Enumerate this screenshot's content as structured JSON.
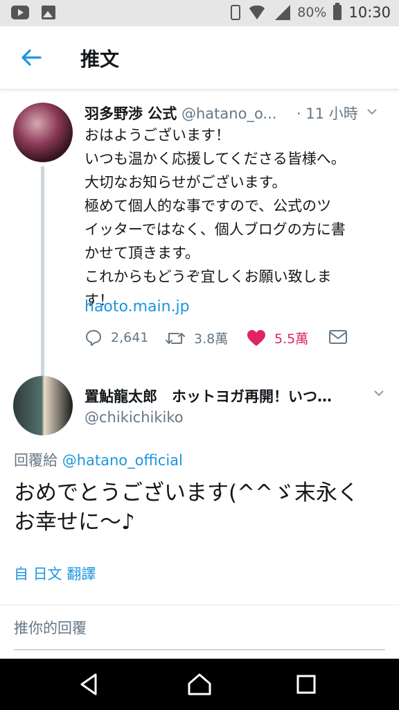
{
  "status_bar": {
    "battery": "80%",
    "time": "10:30"
  },
  "appbar": {
    "title": "推文"
  },
  "tweet1": {
    "author_name": "羽多野渉 公式",
    "handle": "@hatano_o...",
    "time": "· 11 小時",
    "lines": [
      "おはようございます！",
      "いつも温かく応援してくださる皆様へ。",
      "大切なお知らせがございます。",
      "極めて個人的な事ですので、公式のツ",
      "イッターではなく、個人ブログの方に書",
      "かせて頂きます。",
      "これからもどうぞ宜しくお願い致しま",
      "す！"
    ],
    "link": "haoto.main.jp",
    "replies": "2,641",
    "retweets": "3.8萬",
    "likes": "5.5萬"
  },
  "tweet2": {
    "author_name": "置鮎龍太郎　ホットヨガ再開！いつ…",
    "handle": "@chikichikiko",
    "reply_prefix": "回覆給 ",
    "reply_handle": "@hatano_official",
    "text_line1": "おめでとうございます(^^ゞ末永く",
    "text_line2": "お幸せに〜♪",
    "translate": "自 日文 翻譯"
  },
  "reply_box": {
    "placeholder": "推你的回覆"
  },
  "colors": {
    "accent": "#1b95e0",
    "like": "#e0245e",
    "muted": "#657786"
  }
}
